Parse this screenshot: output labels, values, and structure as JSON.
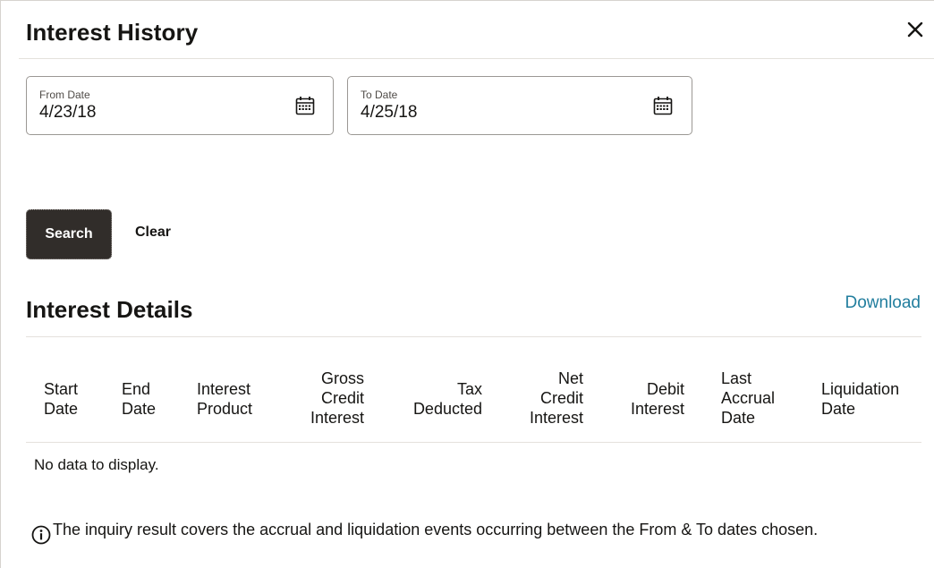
{
  "dialog": {
    "title": "Interest History",
    "close_icon": "close-icon"
  },
  "filters": {
    "from_date": {
      "label": "From Date",
      "value": "4/23/18",
      "icon": "calendar-icon"
    },
    "to_date": {
      "label": "To Date",
      "value": "4/25/18",
      "icon": "calendar-icon"
    }
  },
  "actions": {
    "search_label": "Search",
    "clear_label": "Clear"
  },
  "details": {
    "title": "Interest Details",
    "download_label": "Download",
    "columns": [
      {
        "line1": "Start",
        "line2": "Date",
        "line3": ""
      },
      {
        "line1": "End",
        "line2": "Date",
        "line3": ""
      },
      {
        "line1": "Interest",
        "line2": "Product",
        "line3": ""
      },
      {
        "line1": "Gross",
        "line2": "Credit",
        "line3": "Interest"
      },
      {
        "line1": "Tax",
        "line2": "Deducted",
        "line3": ""
      },
      {
        "line1": "Net",
        "line2": "Credit",
        "line3": "Interest"
      },
      {
        "line1": "Debit",
        "line2": "Interest",
        "line3": ""
      },
      {
        "line1": "Last",
        "line2": "Accrual",
        "line3": "Date"
      },
      {
        "line1": "Liquidation",
        "line2": "Date",
        "line3": ""
      }
    ],
    "empty_text": "No data to display.",
    "info_icon": "info-icon",
    "info_text": "The inquiry result covers the accrual and liquidation events occurring between the From & To dates chosen."
  },
  "colors": {
    "primary_button": "#312d2a",
    "link": "#227e9e",
    "text": "#161513",
    "divider": "#e4e1dc"
  }
}
